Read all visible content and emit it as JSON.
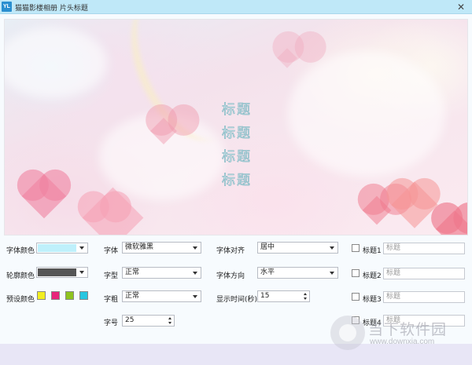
{
  "window": {
    "icon_text": "YL",
    "title": "猫猫影楼相册  片头标题",
    "close_glyph": "✕"
  },
  "preview": {
    "caption_lines": [
      "标题",
      "标题",
      "标题",
      "标题"
    ]
  },
  "controls": {
    "font_color": {
      "label": "字体颜色",
      "value": "#bff0fb"
    },
    "outline_color": {
      "label": "轮廓颜色",
      "value": "#555555"
    },
    "preset_colors": {
      "label": "预设颜色",
      "colors": [
        "#f2ee20",
        "#e8257a",
        "#8fc31f",
        "#27c6e0"
      ]
    },
    "font": {
      "label": "字体",
      "value": "微软雅黑"
    },
    "font_style": {
      "label": "字型",
      "value": "正常"
    },
    "font_weight": {
      "label": "字粗",
      "value": "正常"
    },
    "font_size": {
      "label": "字号",
      "value": "25"
    },
    "alignment": {
      "label": "字体对齐",
      "value": "居中"
    },
    "direction": {
      "label": "字体方向",
      "value": "水平"
    },
    "duration": {
      "label": "显示时间(秒)",
      "value": "15"
    },
    "titles": [
      {
        "label": "标题1",
        "placeholder": "标题"
      },
      {
        "label": "标题2",
        "placeholder": "标题"
      },
      {
        "label": "标题3",
        "placeholder": "标题"
      },
      {
        "label": "标题4",
        "placeholder": "标题"
      }
    ]
  },
  "watermark": {
    "text": "当下软件园",
    "url": "www.downxia.com"
  }
}
